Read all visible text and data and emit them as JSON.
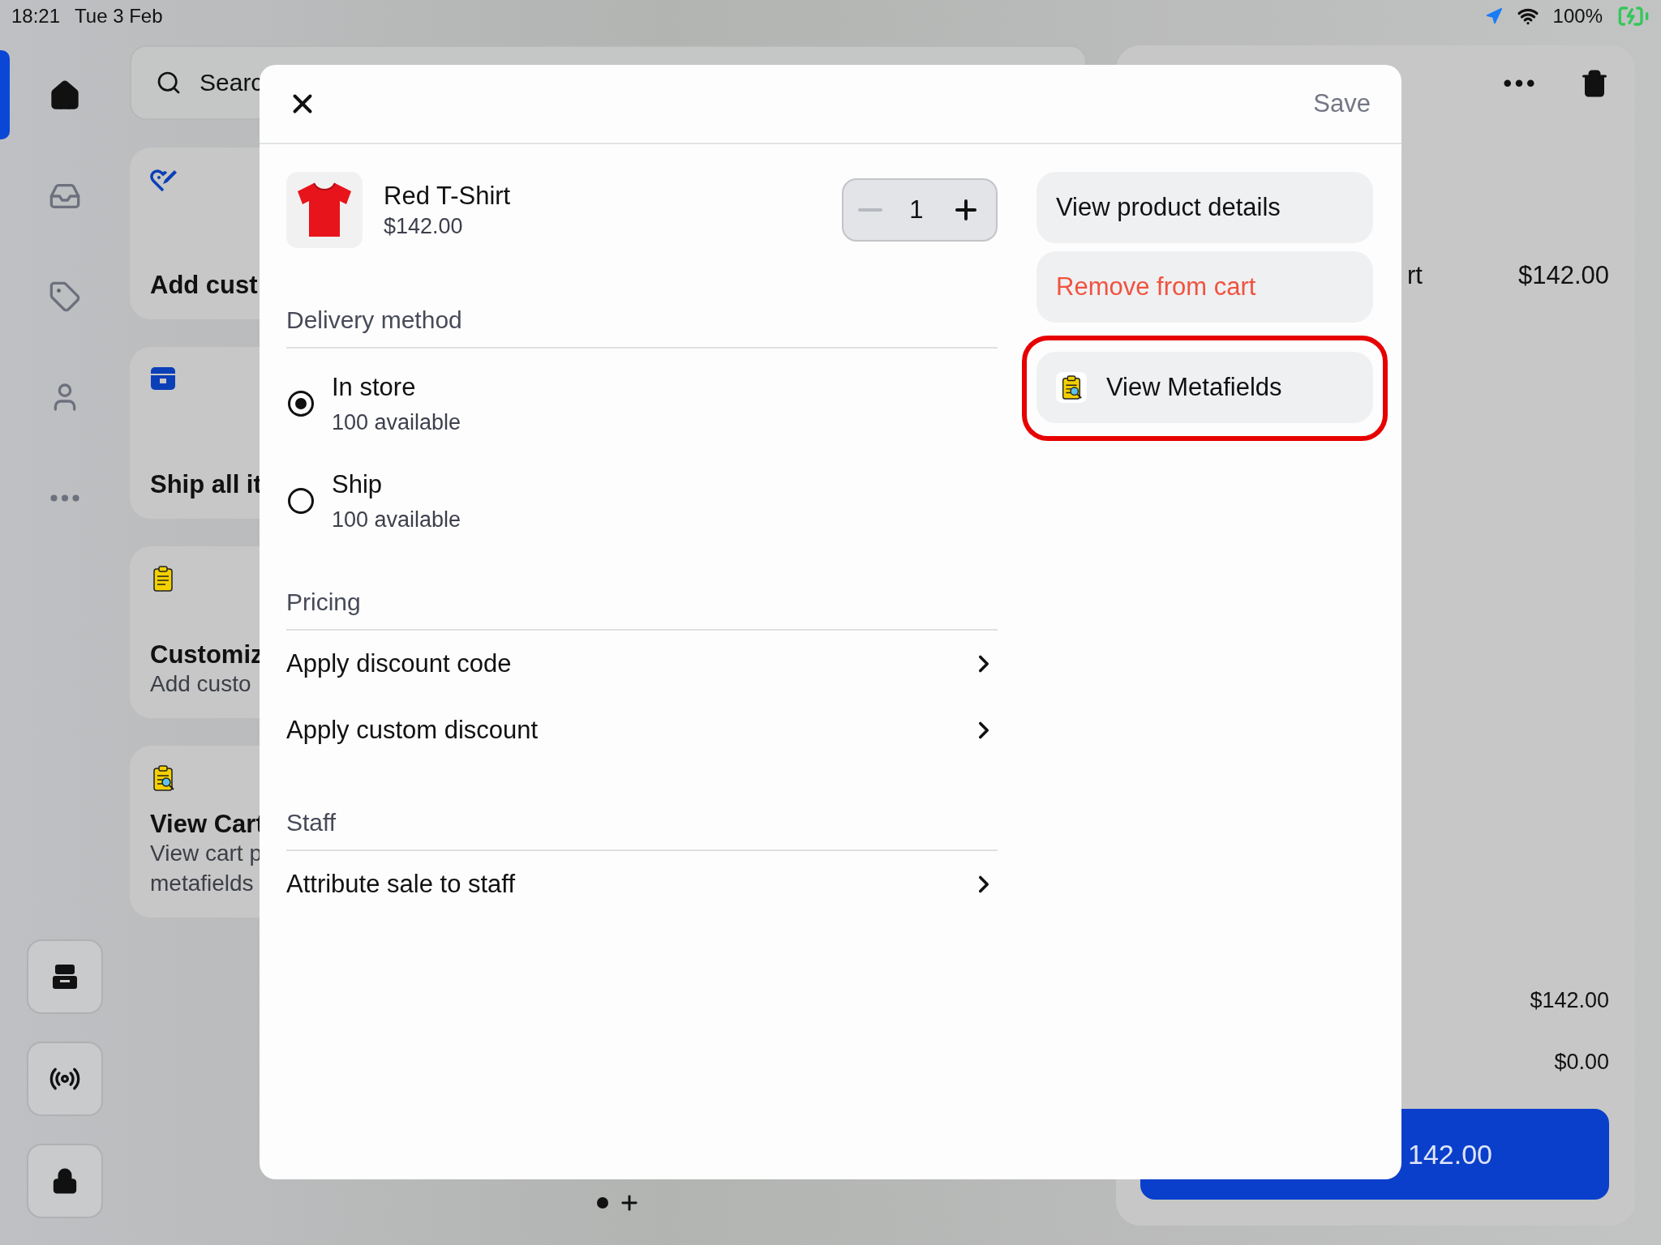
{
  "status_bar": {
    "time": "18:21",
    "date": "Tue 3 Feb",
    "battery": "100%"
  },
  "sidebar": {
    "items": [
      {
        "kind": "home",
        "selected": true
      },
      {
        "kind": "inbox",
        "selected": false
      },
      {
        "kind": "tag",
        "selected": false
      },
      {
        "kind": "person",
        "selected": false
      },
      {
        "kind": "more",
        "selected": false
      }
    ],
    "bottom": [
      {
        "kind": "store"
      },
      {
        "kind": "broadcast"
      },
      {
        "kind": "lock"
      }
    ]
  },
  "search": {
    "placeholder": "Searc"
  },
  "tiles": [
    {
      "kind": "discount",
      "title": "Add cust"
    },
    {
      "kind": "box",
      "title": "Ship all it"
    },
    {
      "kind": "clipboard",
      "title": "Customiz",
      "lines": [
        "Add custo"
      ]
    },
    {
      "kind": "metafields",
      "title": "View Cart",
      "lines": [
        "View cart p",
        "metafields"
      ]
    }
  ],
  "cart": {
    "line_label": "rt",
    "line_price": "$142.00",
    "subtotal": "$142.00",
    "tax": "$0.00",
    "checkout": "142.00"
  },
  "modal": {
    "save": {
      "label": "Save",
      "disabled": true
    },
    "product": {
      "name": "Red T-Shirt",
      "price": "$142.00",
      "quantity": "1",
      "decrease_disabled": true
    },
    "delivery": {
      "heading": "Delivery method",
      "options": [
        {
          "label": "In store",
          "detail": "100 available",
          "selected": true
        },
        {
          "label": "Ship",
          "detail": "100 available",
          "selected": false
        }
      ]
    },
    "pricing": {
      "heading": "Pricing",
      "items": [
        "Apply discount code",
        "Apply custom discount"
      ]
    },
    "staff": {
      "heading": "Staff",
      "items": [
        "Attribute sale to staff"
      ]
    },
    "actions": [
      {
        "kind": "plain",
        "label": "View product details"
      },
      {
        "kind": "destructive",
        "label": "Remove from cart"
      },
      {
        "kind": "icon",
        "label": "View Metafields",
        "highlighted": true
      }
    ]
  }
}
